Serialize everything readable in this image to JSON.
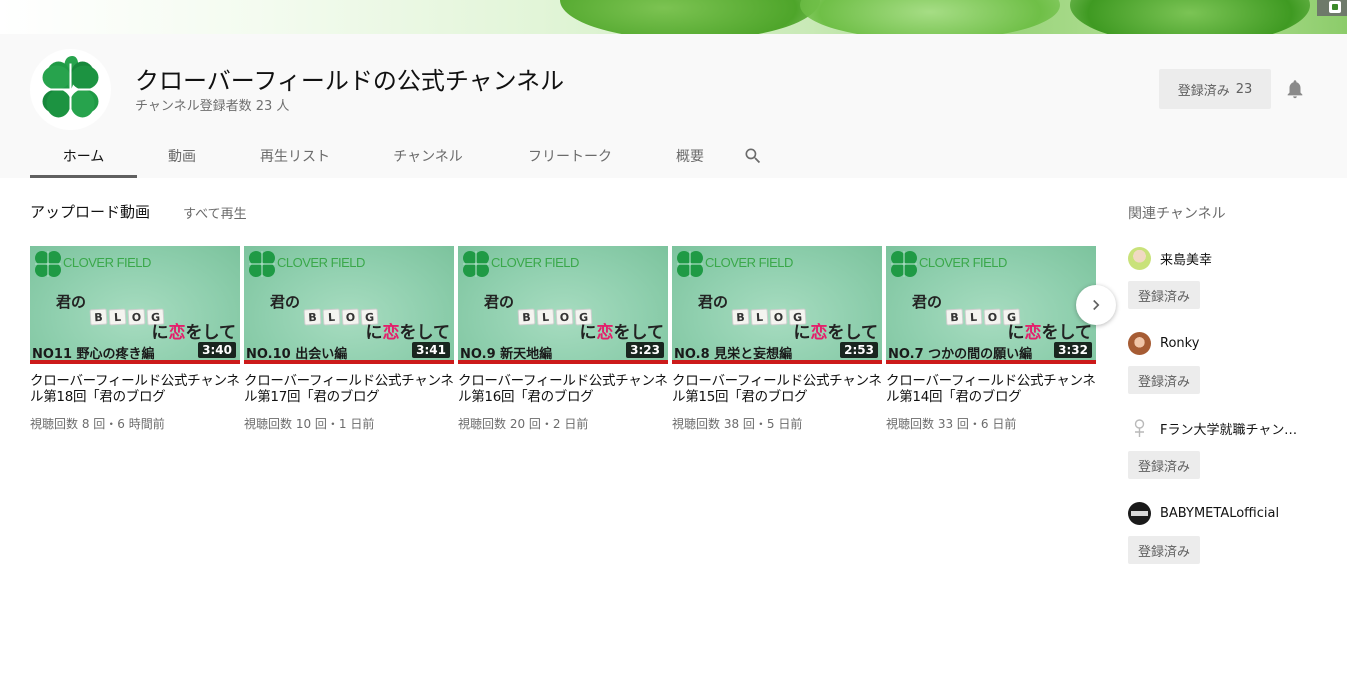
{
  "channel": {
    "title": "クローバーフィールドの公式チャンネル",
    "subscribers_text": "チャンネル登録者数 23 人",
    "subscribe_label": "登録済み",
    "subscribe_count": "23",
    "bell_icon": "bell-icon",
    "avatar_icon": "clover-icon"
  },
  "tabs": [
    {
      "label": "ホーム",
      "active": true
    },
    {
      "label": "動画"
    },
    {
      "label": "再生リスト"
    },
    {
      "label": "チャンネル"
    },
    {
      "label": "フリートーク"
    },
    {
      "label": "概要"
    }
  ],
  "search_icon": "search-icon",
  "uploads": {
    "title": "アップロード動画",
    "play_all": "すべて再生",
    "next_icon": "chevron-right-icon",
    "videos": [
      {
        "thumb": {
          "brand": "CLOVER FIELD",
          "kimi": "君の",
          "blog": "BLOG",
          "koi_pre": "に",
          "koi_red": "恋",
          "koi_post": "をして",
          "episode": "NO11 野心の疼き編"
        },
        "duration": "3:40",
        "title": "クローバーフィールド公式チャンネル第18回「君のブログ",
        "meta": "視聴回数 8 回・6 時間前"
      },
      {
        "thumb": {
          "brand": "CLOVER FIELD",
          "kimi": "君の",
          "blog": "BLOG",
          "koi_pre": "に",
          "koi_red": "恋",
          "koi_post": "をして",
          "episode": "NO.10 出会い編"
        },
        "duration": "3:41",
        "title": "クローバーフィールド公式チャンネル第17回「君のブログ",
        "meta": "視聴回数 10 回・1 日前"
      },
      {
        "thumb": {
          "brand": "CLOVER FIELD",
          "kimi": "君の",
          "blog": "BLOG",
          "koi_pre": "に",
          "koi_red": "恋",
          "koi_post": "をして",
          "episode": "NO.9 新天地編"
        },
        "duration": "3:23",
        "title": "クローバーフィールド公式チャンネル第16回「君のブログ",
        "meta": "視聴回数 20 回・2 日前"
      },
      {
        "thumb": {
          "brand": "CLOVER FIELD",
          "kimi": "君の",
          "blog": "BLOG",
          "koi_pre": "に",
          "koi_red": "恋",
          "koi_post": "をして",
          "episode": "NO.8 見栄と妄想編"
        },
        "duration": "2:53",
        "title": "クローバーフィールド公式チャンネル第15回「君のブログ",
        "meta": "視聴回数 38 回・5 日前"
      },
      {
        "thumb": {
          "brand": "CLOVER FIELD",
          "kimi": "君の",
          "blog": "BLOG",
          "koi_pre": "に",
          "koi_red": "恋",
          "koi_post": "をして",
          "episode": "NO.7 つかの間の願い編"
        },
        "duration": "3:32",
        "title": "クローバーフィールド公式チャンネル第14回「君のブログ",
        "meta": "視聴回数 33 回・6 日前"
      }
    ]
  },
  "related": {
    "title": "関連チャンネル",
    "channels": [
      {
        "name": "来島美幸",
        "button": "登録済み",
        "avatar_color": "#c9e27a"
      },
      {
        "name": "Ronky",
        "button": "登録済み",
        "avatar_color": "#c98a5a"
      },
      {
        "name": "Fラン大学就職チャンネル",
        "button": "登録済み",
        "avatar_color": "#ffffff"
      },
      {
        "name": "BABYMETALofficial",
        "button": "登録済み",
        "avatar_color": "#1a1a1a"
      }
    ]
  },
  "colors": {
    "accent_red": "#cc1a1a",
    "clover_green": "#1f9a45",
    "header_bg": "#f9f9f9"
  }
}
